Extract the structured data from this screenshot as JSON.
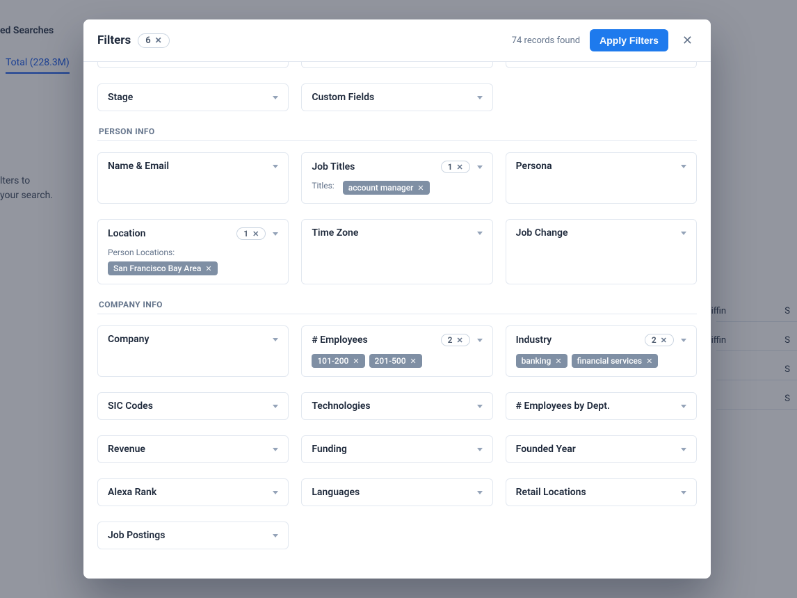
{
  "background": {
    "saved_searches_label": "ed Searches",
    "tab_total_label": "Total (228.3M)",
    "helper_line1": "lters to",
    "helper_line2": "your search.",
    "row_name1": "iffin",
    "row_name2": "iffin",
    "row_letter": "S"
  },
  "modal": {
    "title": "Filters",
    "active_count": "6",
    "records_found": "74 records found",
    "apply_label": "Apply Filters"
  },
  "sections": {
    "person_info_label": "PERSON INFO",
    "company_info_label": "COMPANY INFO"
  },
  "filters": {
    "row0a": {
      "label": ""
    },
    "row0b": {
      "label": ""
    },
    "row0c": {
      "label": ""
    },
    "stage": {
      "label": "Stage"
    },
    "custom_fields": {
      "label": "Custom Fields"
    },
    "name_email": {
      "label": "Name & Email"
    },
    "job_titles": {
      "label": "Job Titles",
      "count": "1",
      "sub_label": "Titles:",
      "chips": [
        "account manager"
      ]
    },
    "persona": {
      "label": "Persona"
    },
    "location": {
      "label": "Location",
      "count": "1",
      "sub_label": "Person Locations:",
      "chips": [
        "San Francisco Bay Area"
      ]
    },
    "time_zone": {
      "label": "Time Zone"
    },
    "job_change": {
      "label": "Job Change"
    },
    "company": {
      "label": "Company"
    },
    "employees": {
      "label": "# Employees",
      "count": "2",
      "chips": [
        "101-200",
        "201-500"
      ]
    },
    "industry": {
      "label": "Industry",
      "count": "2",
      "chips": [
        "banking",
        "financial services"
      ]
    },
    "sic_codes": {
      "label": "SIC Codes"
    },
    "technologies": {
      "label": "Technologies"
    },
    "employees_dept": {
      "label": "# Employees by Dept."
    },
    "revenue": {
      "label": "Revenue"
    },
    "funding": {
      "label": "Funding"
    },
    "founded_year": {
      "label": "Founded Year"
    },
    "alexa_rank": {
      "label": "Alexa Rank"
    },
    "languages": {
      "label": "Languages"
    },
    "retail_locations": {
      "label": "Retail Locations"
    },
    "job_postings": {
      "label": "Job Postings"
    }
  }
}
